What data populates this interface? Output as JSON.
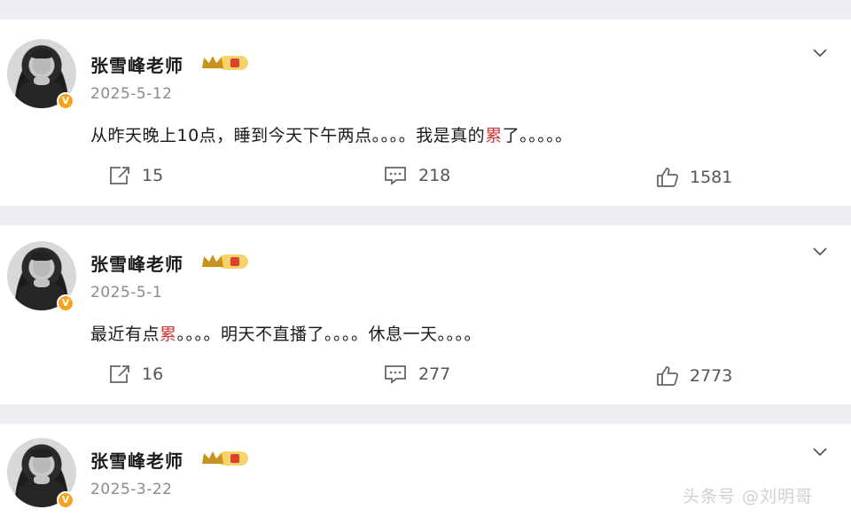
{
  "posts": [
    {
      "author": "张雪峰老师",
      "vip_badge": "crown-vip-badge",
      "date": "2025-5-12",
      "text_before": "从昨天晚上10点，睡到今天下午两点。。。。我是真的",
      "text_highlight": "累",
      "text_after": "了。。。。。",
      "repost_count": "15",
      "comment_count": "218",
      "like_count": "1581"
    },
    {
      "author": "张雪峰老师",
      "vip_badge": "crown-vip-badge",
      "date": "2025-5-1",
      "text_before": "最近有点",
      "text_highlight": "累",
      "text_after": "。。。。明天不直播了。。。。休息一天。。。。",
      "repost_count": "16",
      "comment_count": "277",
      "like_count": "2773"
    },
    {
      "author": "张雪峰老师",
      "vip_badge": "crown-vip-badge",
      "date": "2025-3-22"
    }
  ],
  "watermark": "头条号 @刘明哥",
  "colors": {
    "highlight": "#d13a3a",
    "verified_badge": "#f7a21a",
    "crown": "#c9931f"
  }
}
